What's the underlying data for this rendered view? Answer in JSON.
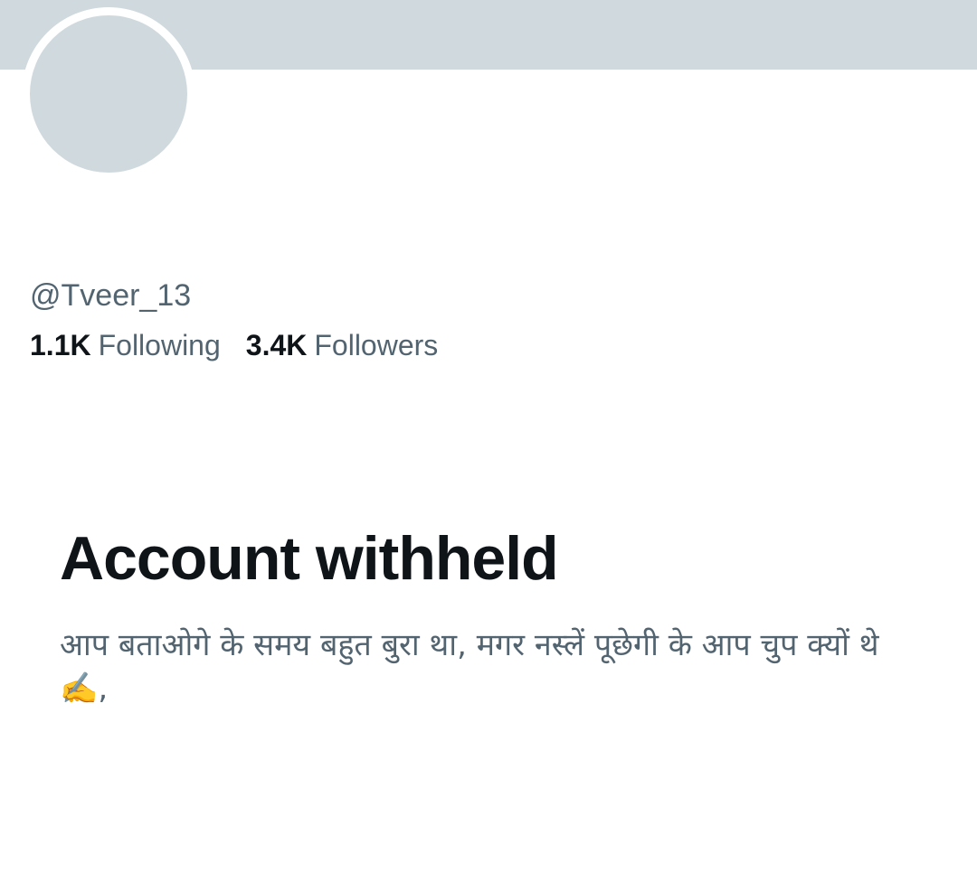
{
  "profile": {
    "handle": "@Tveer_13",
    "following_count": "1.1K",
    "following_label": "Following",
    "followers_count": "3.4K",
    "followers_label": "Followers"
  },
  "withheld": {
    "title": "Account withheld",
    "reason": "आप बताओगे के समय बहुत बुरा था, मगर नस्लें पूछेगी के आप चुप क्यों थे ✍️,"
  },
  "colors": {
    "banner": "#cfd9de",
    "avatar_placeholder": "#cfd9de",
    "primary_text": "#0f1419",
    "secondary_text": "#536471"
  }
}
